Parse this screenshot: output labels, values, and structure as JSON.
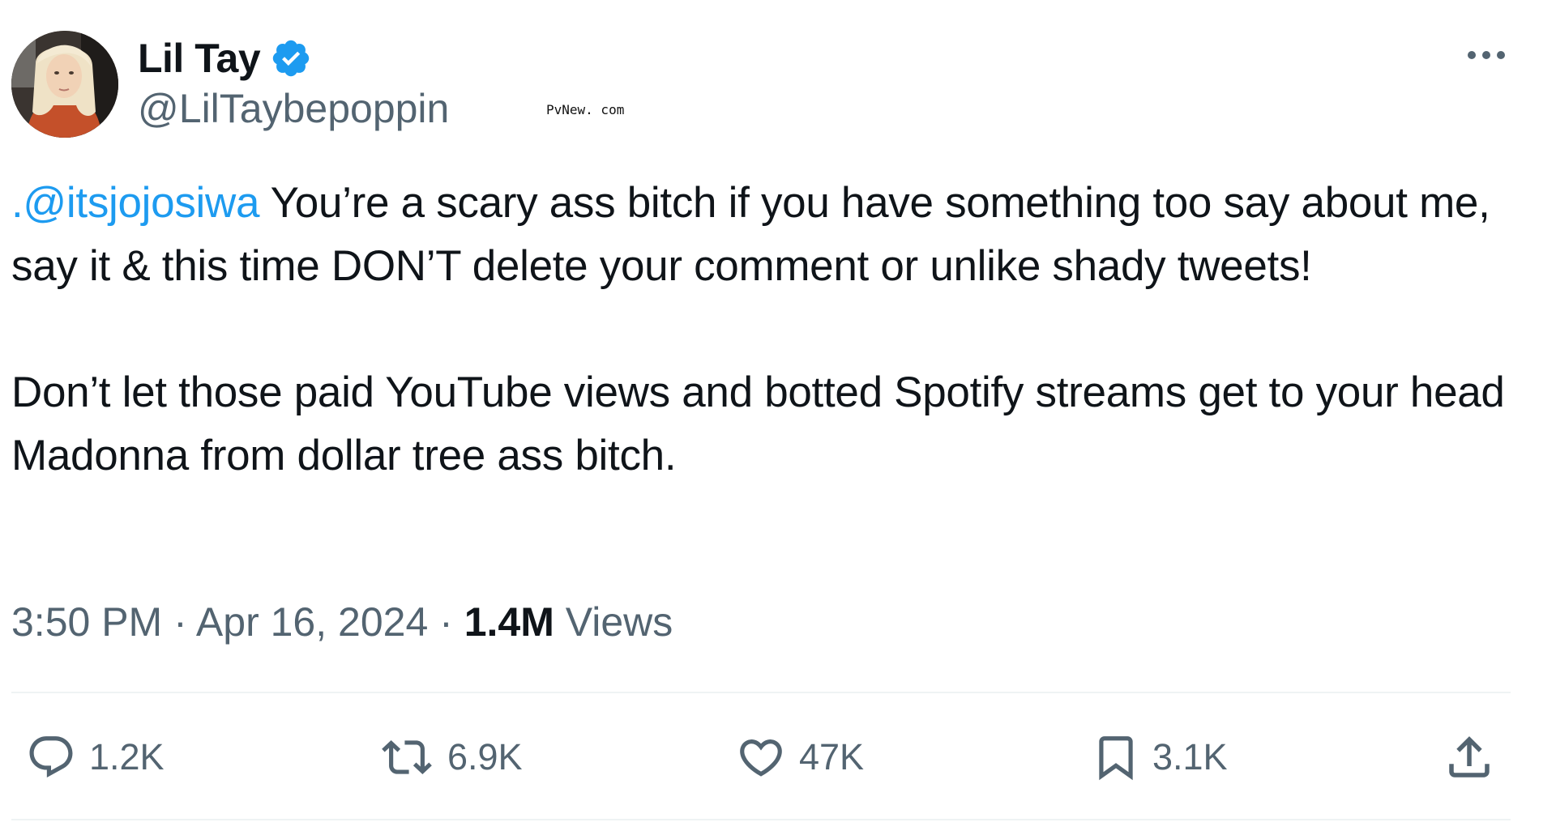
{
  "author": {
    "display_name": "Lil Tay",
    "handle": "@LilTaybepoppin",
    "verified": true,
    "verified_icon": "verified-badge-icon"
  },
  "watermark": "PvNew. com",
  "tweet": {
    "mention": ".@itsjojosiwa",
    "paragraph_1": "You’re a scary ass bitch if you have something too say about me, say it & this time DON’T delete your comment or unlike shady tweets!",
    "paragraph_2": "Don’t let those paid YouTube views and botted Spotify streams get to your head Madonna from dollar tree ass bitch."
  },
  "meta": {
    "time": "3:50 PM",
    "separator": "·",
    "date": "Apr 16, 2024",
    "views_count": "1.4M",
    "views_label": "Views"
  },
  "actions": {
    "reply": {
      "icon": "reply-icon",
      "count": "1.2K"
    },
    "retweet": {
      "icon": "retweet-icon",
      "count": "6.9K"
    },
    "like": {
      "icon": "heart-icon",
      "count": "47K"
    },
    "bookmark": {
      "icon": "bookmark-icon",
      "count": "3.1K"
    },
    "share": {
      "icon": "share-icon"
    }
  },
  "colors": {
    "link": "#1d9bf0",
    "secondary_text": "#536471",
    "primary_text": "#0f1419",
    "divider": "#eff3f4"
  }
}
